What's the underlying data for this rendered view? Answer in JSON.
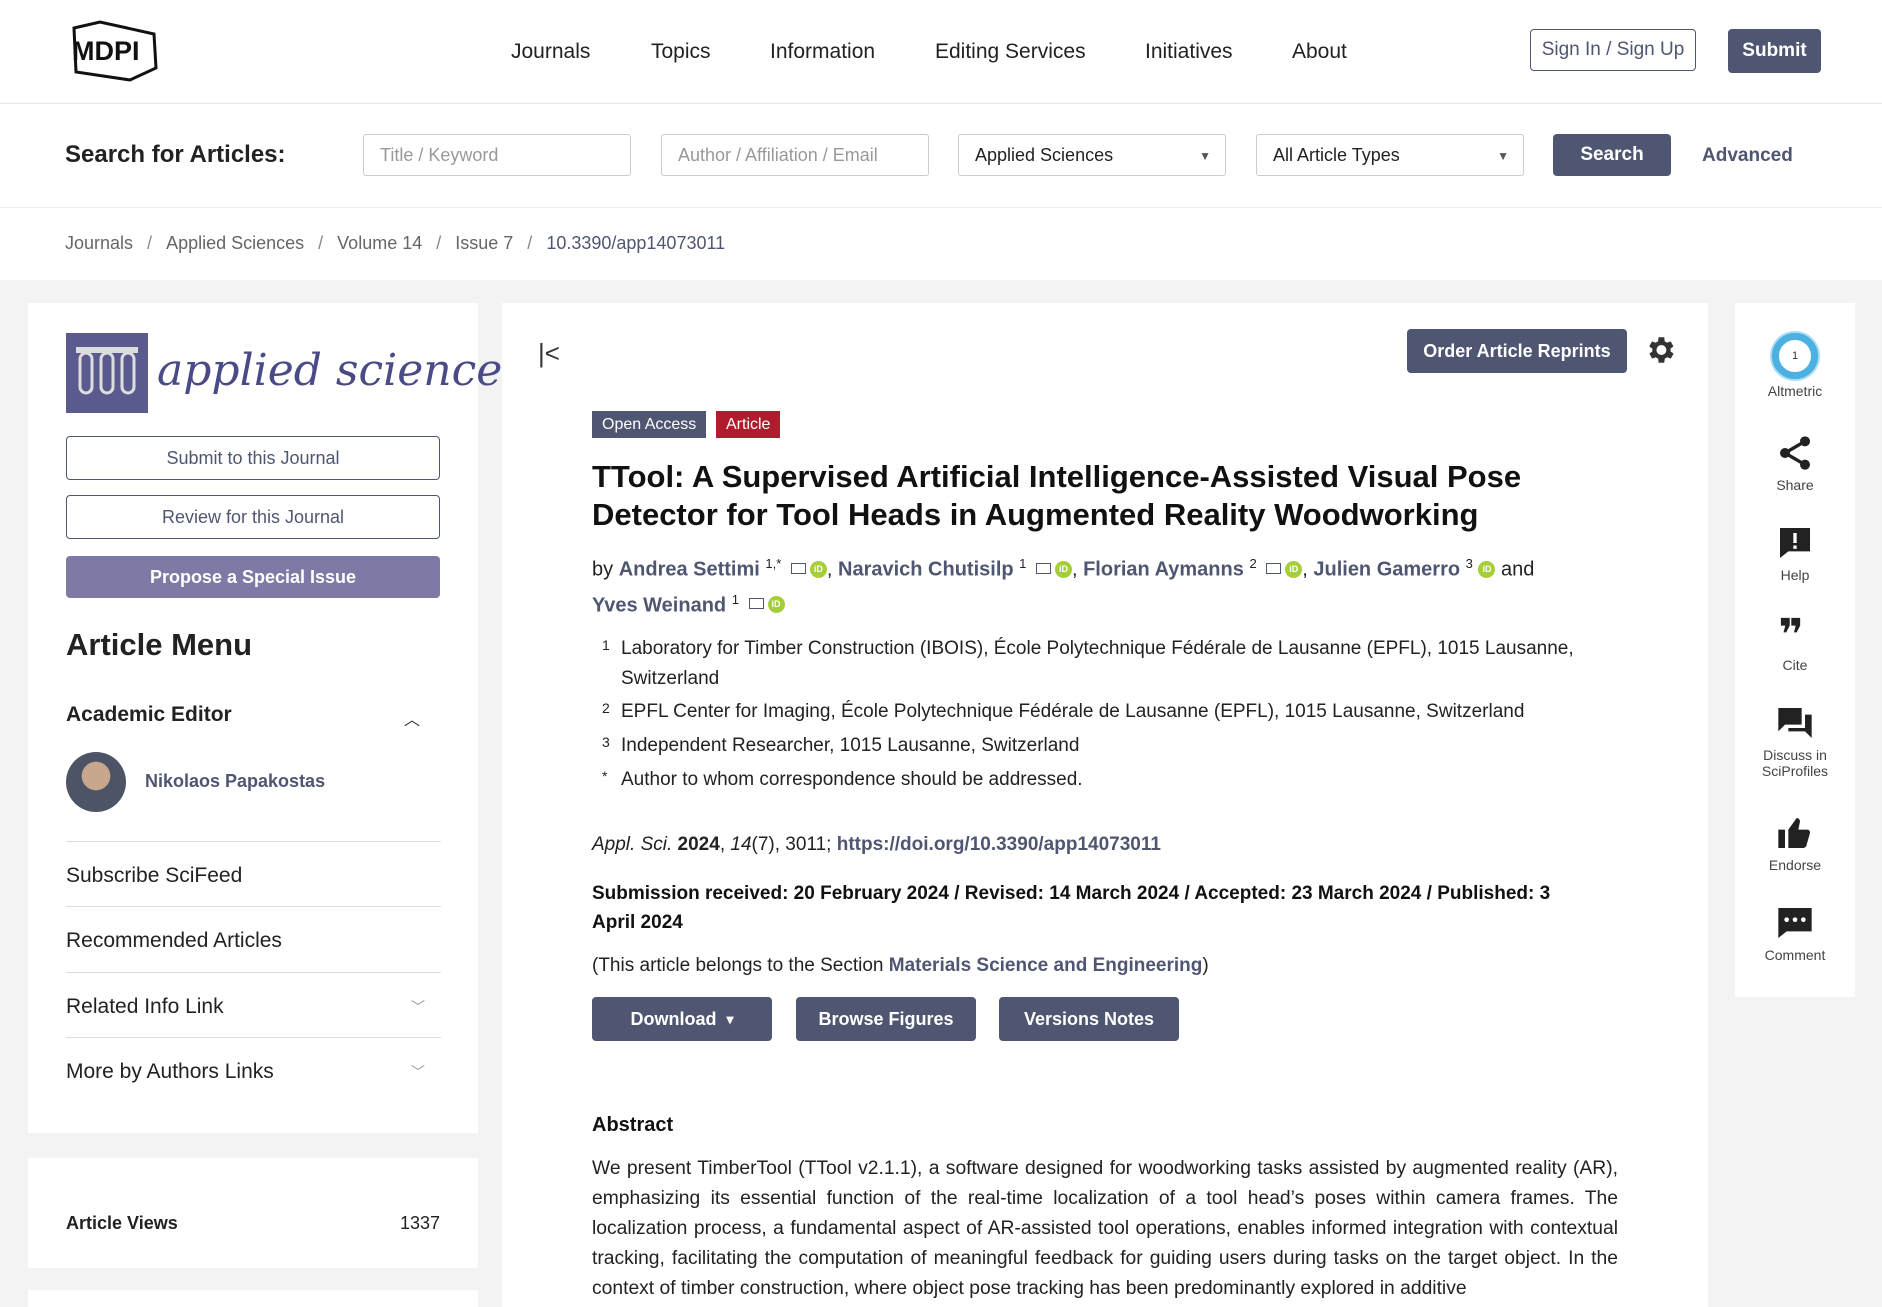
{
  "header": {
    "logo_text": "MDPI",
    "nav": [
      "Journals",
      "Topics",
      "Information",
      "Editing Services",
      "Initiatives",
      "About"
    ],
    "signin_label": "Sign In / Sign Up",
    "submit_label": "Submit"
  },
  "search": {
    "label": "Search for Articles:",
    "keyword_placeholder": "Title / Keyword",
    "author_placeholder": "Author / Affiliation / Email",
    "journal_selected": "Applied Sciences",
    "type_selected": "All Article Types",
    "search_button": "Search",
    "advanced_label": "Advanced"
  },
  "breadcrumb": [
    "Journals",
    "Applied Sciences",
    "Volume 14",
    "Issue 7",
    "10.3390/app14073011"
  ],
  "sidebar": {
    "journal_name": "applied sciences",
    "submit_btn": "Submit to this Journal",
    "review_btn": "Review for this Journal",
    "propose_btn": "Propose a Special Issue",
    "article_menu_title": "Article Menu",
    "academic_editor_label": "Academic Editor",
    "editor_name": "Nikolaos Papakostas",
    "menu_items": [
      "Subscribe SciFeed",
      "Recommended Articles",
      "Related Info Link",
      "More by Authors Links"
    ],
    "views_label": "Article Views",
    "views_value": "1337"
  },
  "article": {
    "reprints_btn": "Order Article Reprints",
    "badge_open_access": "Open Access",
    "badge_article": "Article",
    "title": "TTool: A Supervised Artificial Intelligence-Assisted Visual Pose Detector for Tool Heads in Augmented Reality Woodworking",
    "by": "by",
    "and": "and",
    "authors": [
      {
        "name": "Andrea Settimi",
        "sup": "1,*"
      },
      {
        "name": "Naravich Chutisilp",
        "sup": "1"
      },
      {
        "name": "Florian Aymanns",
        "sup": "2"
      },
      {
        "name": "Julien Gamerro",
        "sup": "3"
      },
      {
        "name": "Yves Weinand",
        "sup": "1"
      }
    ],
    "affiliations": [
      {
        "num": "1",
        "text": "Laboratory for Timber Construction (IBOIS), École Polytechnique Fédérale de Lausanne (EPFL), 1015 Lausanne, Switzerland"
      },
      {
        "num": "2",
        "text": "EPFL Center for Imaging, École Polytechnique Fédérale de Lausanne (EPFL), 1015 Lausanne, Switzerland"
      },
      {
        "num": "3",
        "text": "Independent Researcher, 1015 Lausanne, Switzerland"
      },
      {
        "num": "*",
        "text": "Author to whom correspondence should be addressed."
      }
    ],
    "citation": {
      "journal": "Appl. Sci.",
      "year": "2024",
      "volume": "14",
      "issue_pages": "(7), 3011; ",
      "doi": "https://doi.org/10.3390/app14073011"
    },
    "dates": "Submission received: 20 February 2024 / Revised: 14 March 2024 / Accepted: 23 March 2024 / Published: 3 April 2024",
    "section_prefix": "(This article belongs to the Section ",
    "section_name": "Materials Science and Engineering",
    "section_suffix": ")",
    "download_btn": "Download",
    "figures_btn": "Browse Figures",
    "versions_btn": "Versions Notes",
    "abstract_title": "Abstract",
    "abstract_text": "We present TimberTool (TTool v2.1.1), a software designed for woodworking tasks assisted by augmented reality (AR), emphasizing its essential function of the real-time localization of a tool head’s poses within camera frames. The localization process, a fundamental aspect of AR-assisted tool operations, enables informed integration with contextual tracking, facilitating the computation of meaningful feedback for guiding users during tasks on the target object. In the context of timber construction, where object pose tracking has been predominantly explored in additive"
  },
  "rail": {
    "altmetric_score": "1",
    "items": [
      "Altmetric",
      "Share",
      "Help",
      "Cite",
      "Discuss in SciProfiles",
      "Endorse",
      "Comment"
    ]
  },
  "colors": {
    "primary": "#4f5671",
    "article_badge": "#b01c2e",
    "orcid": "#a6ce39",
    "altmetric": "#4cb0e0"
  }
}
